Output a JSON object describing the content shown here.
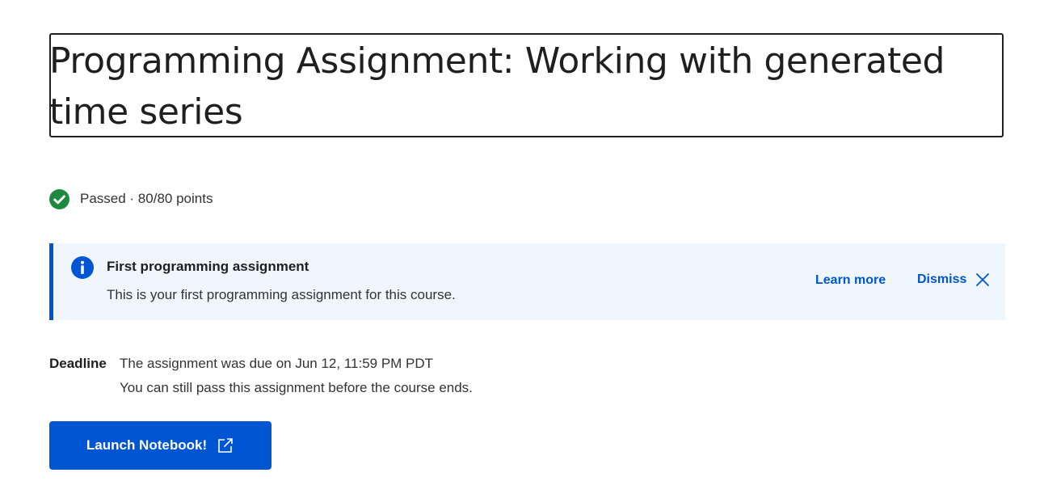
{
  "header": {
    "title": "Programming Assignment: Working with generated time series"
  },
  "status": {
    "icon": "check-circle-icon",
    "text": "Passed · 80/80 points",
    "color": "#1e8a3f"
  },
  "banner": {
    "icon": "info-icon",
    "title": "First programming assignment",
    "text": "This is your first programming assignment for this course.",
    "learn_more_label": "Learn more",
    "dismiss_label": "Dismiss",
    "dismiss_icon": "close-icon",
    "accent": "#0056d2",
    "background": "#f0f6fe"
  },
  "deadline": {
    "label": "Deadline",
    "line1": "The assignment was due on Jun 12, 11:59 PM PDT",
    "line2": "You can still pass this assignment before the course ends."
  },
  "launch": {
    "label": "Launch Notebook!",
    "icon": "external-link-icon",
    "color": "#0056d2"
  }
}
